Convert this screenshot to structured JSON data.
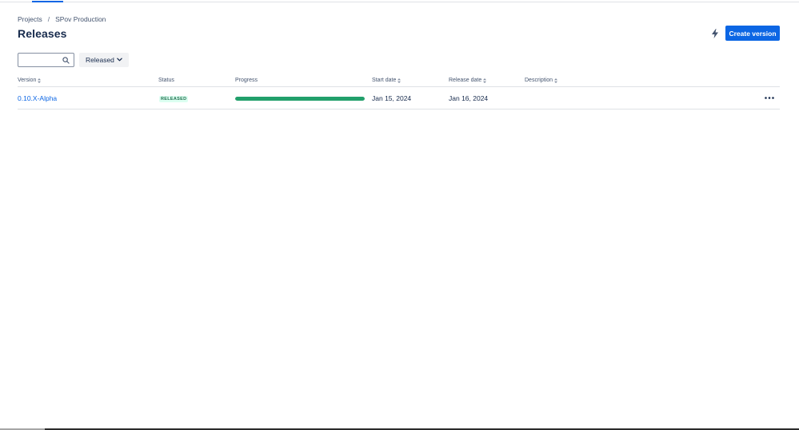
{
  "breadcrumb": {
    "items": [
      "Projects",
      "SPov Production"
    ],
    "separator": "/"
  },
  "page": {
    "title": "Releases"
  },
  "actions": {
    "bolt_icon": "lightning-bolt-icon",
    "create_label": "Create version"
  },
  "filters": {
    "search_value": "",
    "search_placeholder": "",
    "status_filter": "Released"
  },
  "table": {
    "columns": [
      "Version",
      "Status",
      "Progress",
      "Start date",
      "Release date",
      "Description"
    ],
    "rows": [
      {
        "version": "0.10.X-Alpha",
        "status": "RELEASED",
        "progress_percent": 100,
        "start_date": "Jan 15, 2024",
        "release_date": "Jan 16, 2024",
        "description": ""
      }
    ]
  },
  "colors": {
    "primary": "#0c66e4",
    "progress_done": "#22a06b",
    "lozenge_bg": "#dcfff1",
    "lozenge_text": "#216e4e"
  }
}
